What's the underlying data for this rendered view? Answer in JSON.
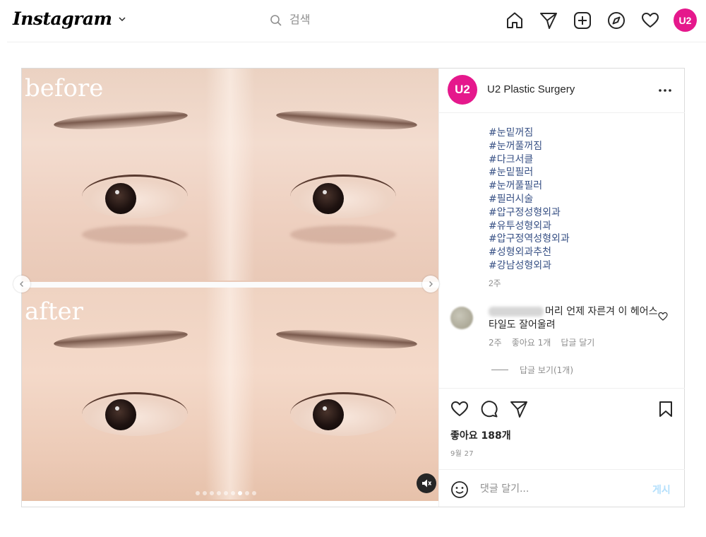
{
  "nav": {
    "logo": "Instagram",
    "search_placeholder": "검색",
    "profile_avatar": "U2",
    "icons": [
      "home-icon",
      "direct-icon",
      "new-post-icon",
      "explore-icon",
      "activity-heart-icon",
      "profile-avatar"
    ]
  },
  "post": {
    "media": {
      "before_label": "before",
      "after_label": "after",
      "slide_count": 9,
      "active_slide": 7
    },
    "header": {
      "avatar": "U2",
      "username": "U2 Plastic Surgery"
    },
    "caption": {
      "hashtags": [
        "#눈밑꺼짐",
        "#눈꺼풀꺼짐",
        "#다크서클",
        "#눈밑필러",
        "#눈꺼풀필러",
        "#필러시술",
        "#압구정성형외과",
        "#유투성형외과",
        "#압구정역성형외과",
        "#성형외과추천",
        "#강남성형외과"
      ],
      "time": "2주"
    },
    "comment": {
      "text": "머리 언제 자른겨 이 헤어스타일도 잘어울려",
      "time": "2주",
      "likes": "좋아요 1개",
      "reply": "답글 달기"
    },
    "view_replies": "답글 보기(1개)",
    "likes": "좋아요 188개",
    "date": "9월 27",
    "comment_placeholder": "댓글 달기...",
    "post_label": "게시"
  },
  "colors": {
    "brand_pink": "#e5188c",
    "hashtag": "#385185",
    "muted": "#8e8e8e",
    "post_button_disabled": "#b2dffc"
  }
}
